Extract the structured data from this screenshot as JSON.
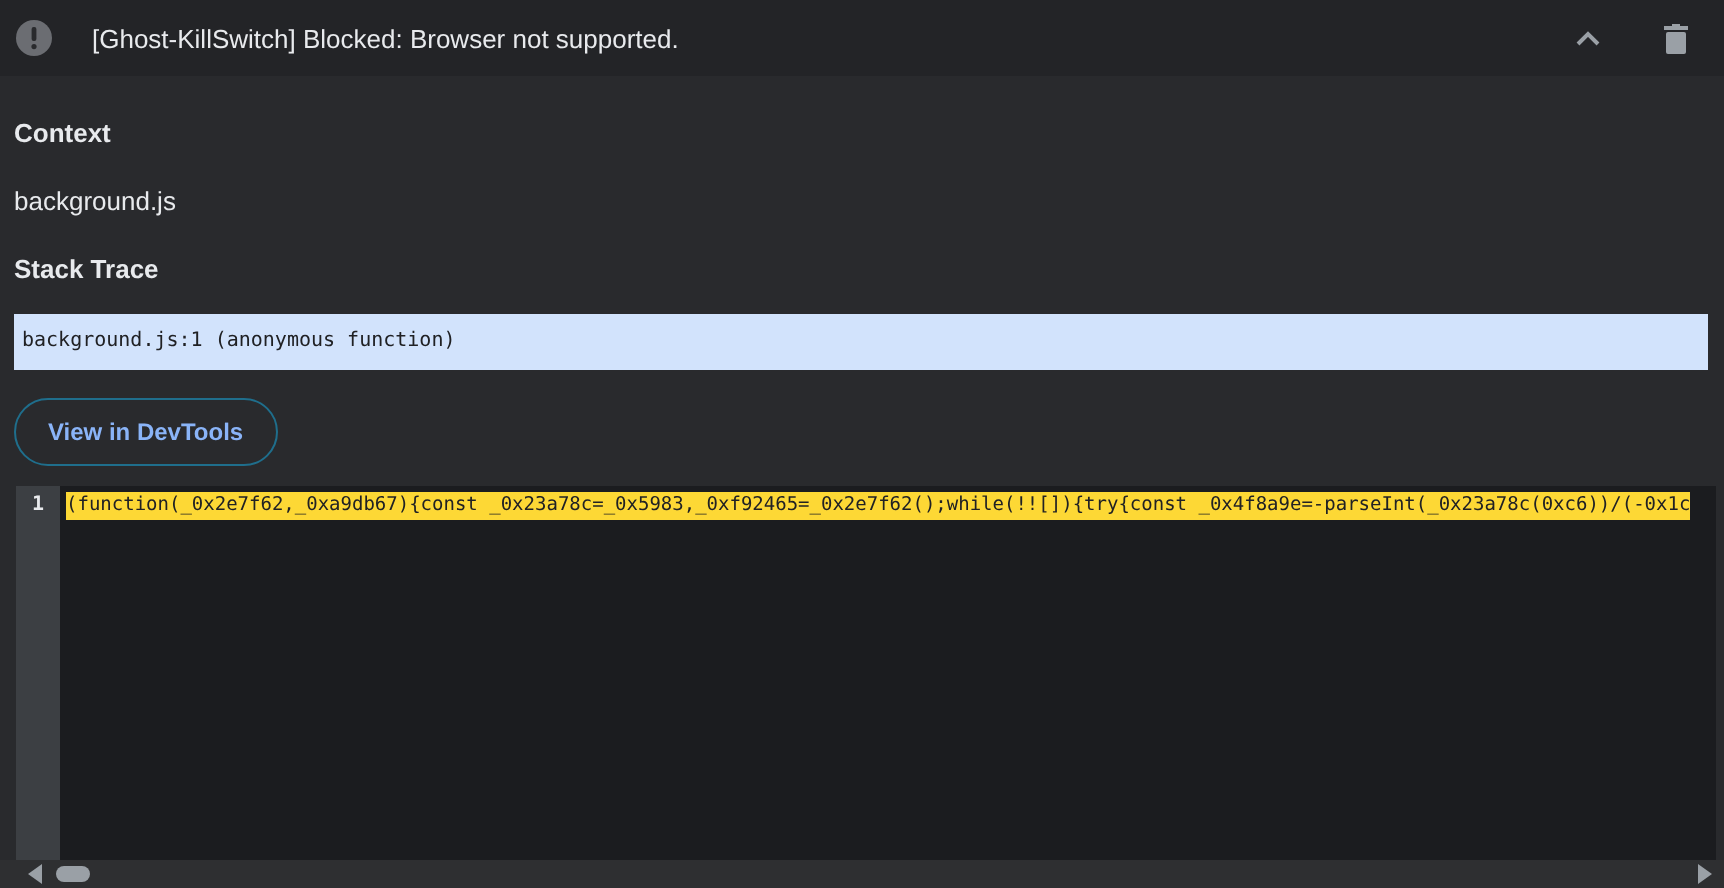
{
  "error": {
    "message": "[Ghost-KillSwitch] Blocked: Browser not supported."
  },
  "context": {
    "heading": "Context",
    "value": "background.js"
  },
  "stack_trace": {
    "heading": "Stack Trace",
    "frames": [
      "background.js:1 (anonymous function)"
    ]
  },
  "devtools_button": "View in DevTools",
  "code": {
    "lines": [
      {
        "number": "1",
        "text": "(function(_0x2e7f62,_0xa9db67){const _0x23a78c=_0x5983,_0xf92465=_0x2e7f62();while(!![]){try{const _0x4f8a9e=-parseInt(_0x23a78c(0xc6))/(-0x1c",
        "highlighted": true
      }
    ]
  }
}
